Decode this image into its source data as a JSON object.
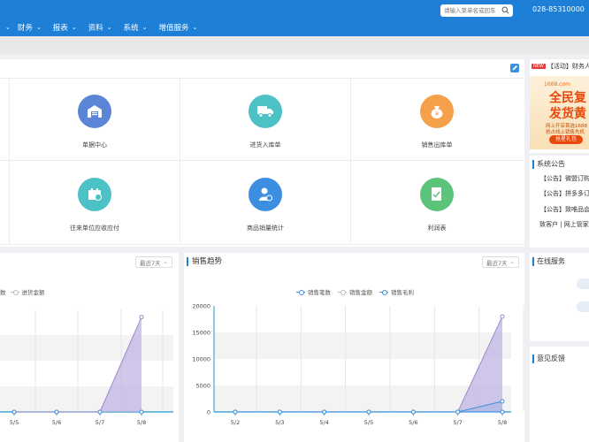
{
  "header": {
    "nav": [
      "财务",
      "报表",
      "资料",
      "系统",
      "增值服务"
    ],
    "search_placeholder": "请输入菜单名或回车",
    "phone": "028-85310000"
  },
  "colors": {
    "primary": "#1e7fd6",
    "purple_area": "#c8b8e6",
    "series_blue": "#3d8fe0"
  },
  "quick_links": [
    {
      "label": "单据中心",
      "icon": "warehouse-icon",
      "color": "#5b86d8"
    },
    {
      "label": "进货入库单",
      "icon": "truck-icon",
      "color": "#4cc1c6"
    },
    {
      "label": "销售出库单",
      "icon": "money-bag-icon",
      "color": "#f5a04a"
    },
    {
      "label": "往来单位应收应付",
      "icon": "cart-icon",
      "color": "#4cc1c6"
    },
    {
      "label": "商品销量统计",
      "icon": "user-stats-icon",
      "color": "#3c8ee0"
    },
    {
      "label": "利润表",
      "icon": "report-icon",
      "color": "#5cc47a"
    }
  ],
  "purchase_chart": {
    "dropdown": "最近7天",
    "legend": [
      "数",
      "进货金额"
    ]
  },
  "sales_chart": {
    "title": "销售趋势",
    "dropdown": "最近7天",
    "legend": [
      "销售笔数",
      "销售金额",
      "销售毛利"
    ]
  },
  "right": {
    "activity": "【活动】财务人",
    "new_badge": "NEW",
    "banner": {
      "brand": "1688.com",
      "line1": "全民复",
      "line2": "发货黄",
      "text1": "网上开店首选1688",
      "text2": "抢占线上销售先机",
      "button": "抢星礼包"
    },
    "notice_title": "系统公告",
    "notices": [
      "【公告】微盟订购",
      "【公告】拼多多订",
      "【公告】致唯品会"
    ],
    "notice_footer": "致客户 | 网上管家",
    "online_service": "在线服务",
    "feedback": "意见反馈"
  },
  "chart_data": [
    {
      "type": "area",
      "title": "",
      "categories": [
        "5/5",
        "5/6",
        "5/7",
        "5/8"
      ],
      "series": [
        {
          "name": "进货金额",
          "values": [
            0,
            0,
            0,
            18500
          ]
        },
        {
          "name": "数",
          "values": [
            0,
            0,
            0,
            0
          ]
        }
      ],
      "ylim": [
        0,
        20000
      ]
    },
    {
      "type": "area",
      "title": "销售趋势",
      "categories": [
        "5/2",
        "5/3",
        "5/4",
        "5/5",
        "5/6",
        "5/7",
        "5/8"
      ],
      "y_ticks": [
        "0",
        "5000",
        "10000",
        "15000",
        "20000"
      ],
      "series": [
        {
          "name": "销售笔数",
          "values": [
            0,
            0,
            0,
            0,
            0,
            0,
            0
          ]
        },
        {
          "name": "销售金额",
          "values": [
            0,
            0,
            0,
            0,
            0,
            0,
            18000
          ]
        },
        {
          "name": "销售毛利",
          "values": [
            0,
            0,
            0,
            0,
            0,
            0,
            2000
          ]
        }
      ],
      "ylim": [
        0,
        20000
      ]
    }
  ]
}
